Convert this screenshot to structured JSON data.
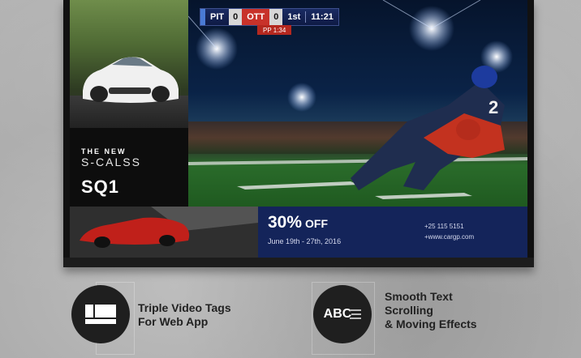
{
  "scoreboard": {
    "team_a": "PIT",
    "score_a": "0",
    "team_b": "OTT",
    "score_b": "0",
    "period": "1st",
    "clock": "11:21",
    "power_play": "PP 1:34"
  },
  "car_promo": {
    "line1": "THE NEW",
    "line2": "S-CALSS",
    "model": "SQ1"
  },
  "ad": {
    "discount": "30%",
    "off": "OFF",
    "dates": "June 19th - 27th, 2016",
    "phone": "+25 115 5151",
    "website": "+www.cargp.com"
  },
  "features": [
    {
      "line1": "Triple Video Tags",
      "line2": "For Web App",
      "icon": "triple-video-icon"
    },
    {
      "line1": "Smooth Text",
      "line2": "Scrolling",
      "line3": "& Moving Effects",
      "icon_text": "ABC",
      "icon": "text-scroll-icon"
    }
  ],
  "colors": {
    "ad_blue": "#14245a",
    "score_red": "#c8322a",
    "score_blue": "#1a2b63"
  }
}
